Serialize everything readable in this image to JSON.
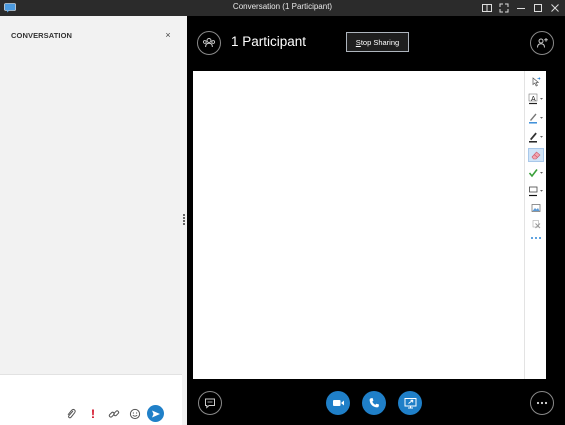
{
  "window": {
    "title": "Conversation (1 Participant)"
  },
  "conversation_panel": {
    "heading": "CONVERSATION",
    "close_symbol": "×"
  },
  "stage": {
    "participants_label": "1 Participant",
    "stop_sharing_label": "Stop Sharing",
    "stop_sharing_mnemonic": "S"
  },
  "compose_toolbar": {
    "icons": [
      "paperclip-icon",
      "exclamation-icon",
      "link-icon",
      "smiley-icon",
      "send-icon"
    ],
    "exclamation_text": "!",
    "exclamation_color": "#d0021b"
  },
  "whiteboard_tools": [
    "selection-icon",
    "text-tool-icon",
    "pen-blue-icon",
    "pen-black-icon",
    "eraser-icon",
    "stamp-check-icon",
    "shape-rectangle-icon",
    "insert-image-icon",
    "delete-icon",
    "more-tools-icon"
  ],
  "bottom_bar": {
    "icons": [
      "chat-bubble-icon",
      "video-camera-icon",
      "phone-icon",
      "present-screen-icon",
      "more-options-icon"
    ]
  },
  "colors": {
    "accent": "#1f7fc8",
    "stage_background": "#000000",
    "panel_background": "#f2f2f2"
  }
}
